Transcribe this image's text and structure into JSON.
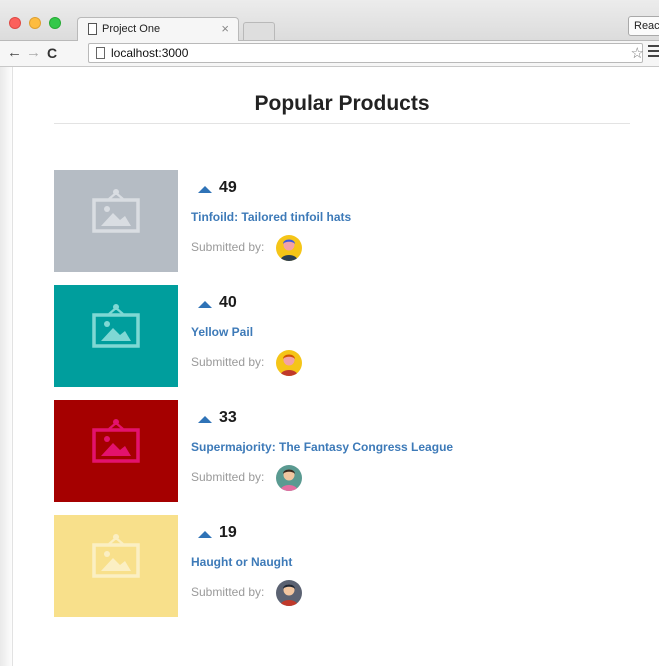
{
  "browser": {
    "tab_title": "Project One",
    "tab_close": "×",
    "url": "localhost:3000",
    "extension_label": "React"
  },
  "page": {
    "title": "Popular Products"
  },
  "products": [
    {
      "votes": "49",
      "title": "Tinfoild: Tailored tinfoil hats",
      "submitted_label": "Submitted by:",
      "thumb_color": "#b5bcc4",
      "icon_color": "#d9dde2",
      "avatar_bg": "#f5c518"
    },
    {
      "votes": "40",
      "title": "Yellow Pail",
      "submitted_label": "Submitted by:",
      "thumb_color": "#009e9d",
      "icon_color": "#7fd8d4",
      "avatar_bg": "#f5c518"
    },
    {
      "votes": "33",
      "title": "Supermajority: The Fantasy Congress League",
      "submitted_label": "Submitted by:",
      "thumb_color": "#a50000",
      "icon_color": "#e3126d",
      "avatar_bg": "#5a9a91"
    },
    {
      "votes": "19",
      "title": "Haught or Naught",
      "submitted_label": "Submitted by:",
      "thumb_color": "#f8e08b",
      "icon_color": "#fbefc3",
      "avatar_bg": "#5b6272"
    }
  ],
  "icons": {
    "upvote": "caret-up-icon",
    "thumbnail": "image-placeholder-icon"
  }
}
